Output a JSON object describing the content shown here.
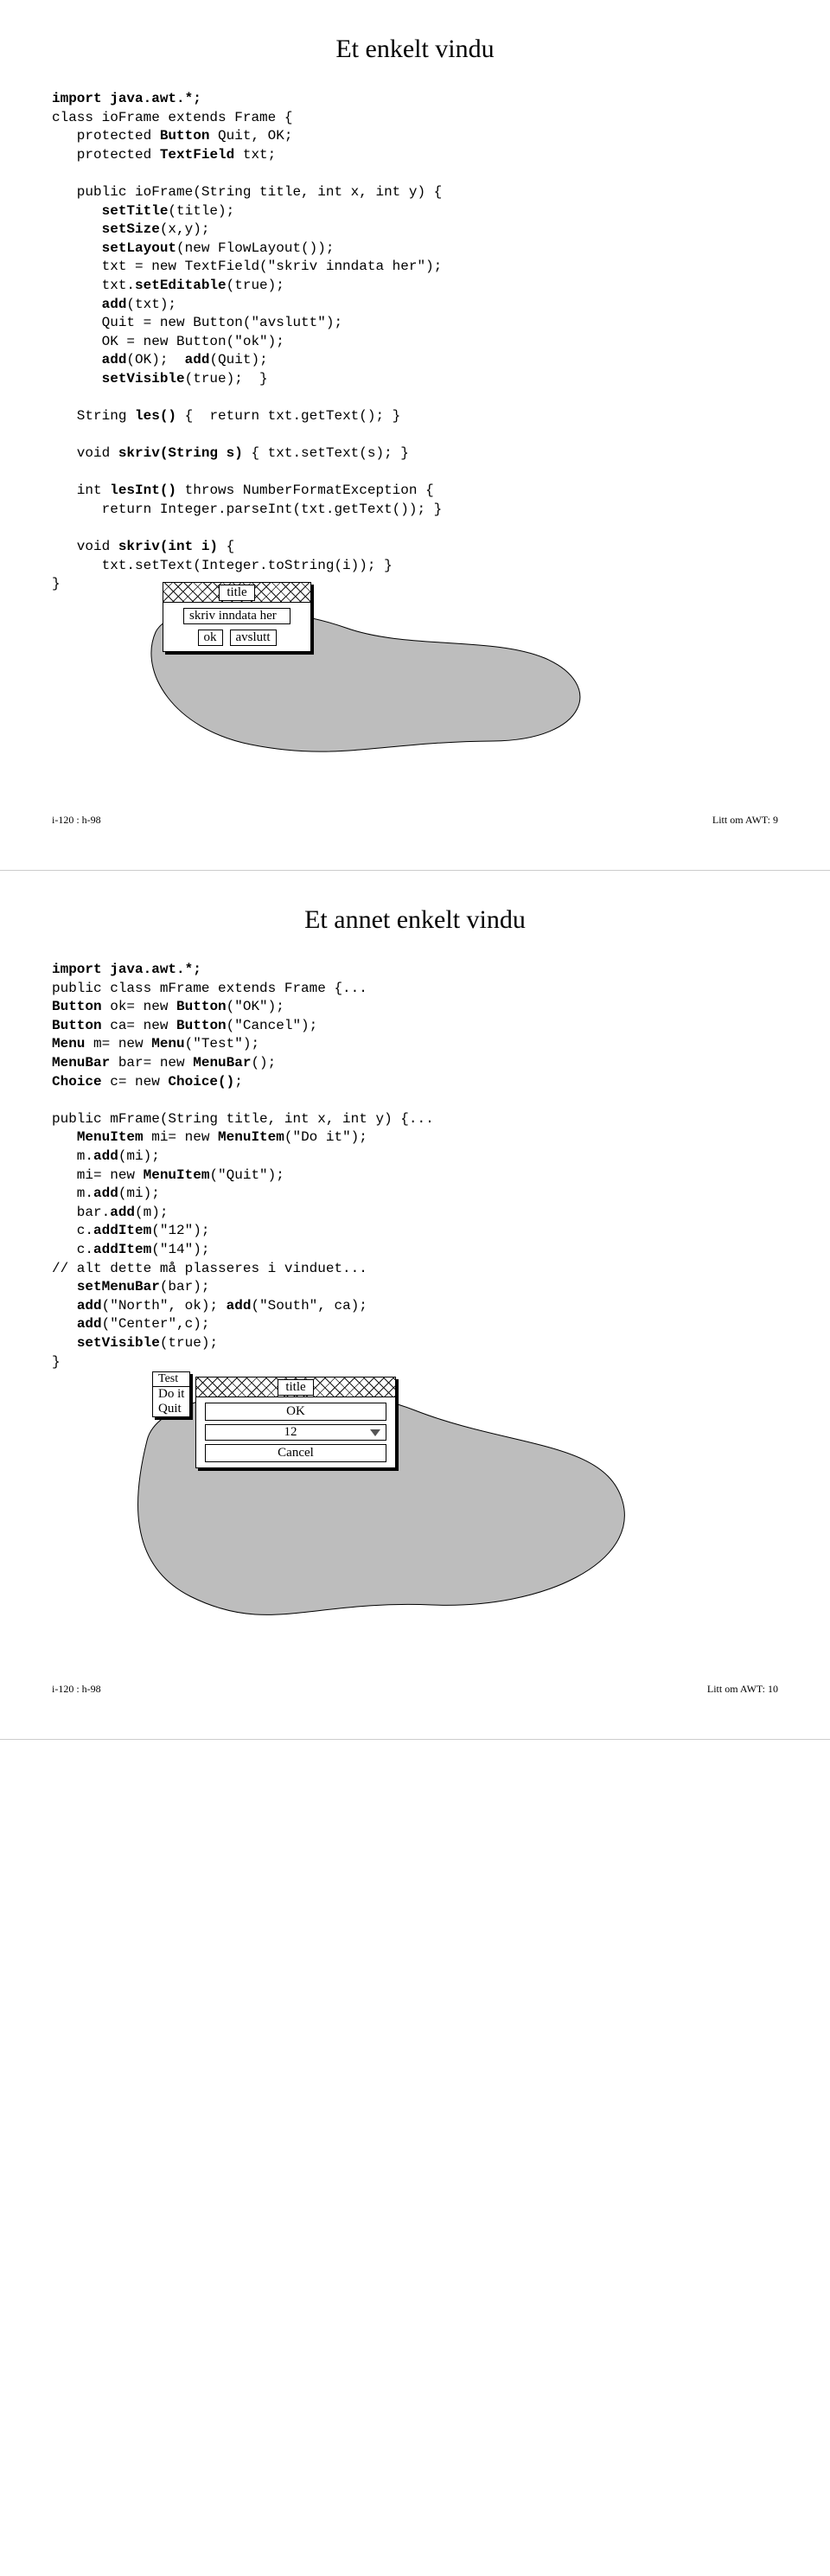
{
  "page1": {
    "title": "Et enkelt vindu",
    "code_lines": [
      [
        {
          "t": "import java.awt.*;",
          "b": 1
        }
      ],
      [
        {
          "t": "class ioFrame extends Frame {",
          "b": 0
        }
      ],
      [
        {
          "t": "   protected ",
          "b": 0
        },
        {
          "t": "Button",
          "b": 1
        },
        {
          "t": " Quit, OK;",
          "b": 0
        }
      ],
      [
        {
          "t": "   protected ",
          "b": 0
        },
        {
          "t": "TextField",
          "b": 1
        },
        {
          "t": " txt;",
          "b": 0
        }
      ],
      [],
      [
        {
          "t": "   public ioFrame(String title, int x, int y) {",
          "b": 0
        }
      ],
      [
        {
          "t": "      ",
          "b": 0
        },
        {
          "t": "setTitle",
          "b": 1
        },
        {
          "t": "(title);",
          "b": 0
        }
      ],
      [
        {
          "t": "      ",
          "b": 0
        },
        {
          "t": "setSize",
          "b": 1
        },
        {
          "t": "(x,y);",
          "b": 0
        }
      ],
      [
        {
          "t": "      ",
          "b": 0
        },
        {
          "t": "setLayout",
          "b": 1
        },
        {
          "t": "(new FlowLayout());",
          "b": 0
        }
      ],
      [
        {
          "t": "      txt = new TextField(\"skriv inndata her\");",
          "b": 0
        }
      ],
      [
        {
          "t": "      txt.",
          "b": 0
        },
        {
          "t": "setEditable",
          "b": 1
        },
        {
          "t": "(true);",
          "b": 0
        }
      ],
      [
        {
          "t": "      ",
          "b": 0
        },
        {
          "t": "add",
          "b": 1
        },
        {
          "t": "(txt);",
          "b": 0
        }
      ],
      [
        {
          "t": "      Quit = new Button(\"avslutt\");",
          "b": 0
        }
      ],
      [
        {
          "t": "      OK = new Button(\"ok\");",
          "b": 0
        }
      ],
      [
        {
          "t": "      ",
          "b": 0
        },
        {
          "t": "add",
          "b": 1
        },
        {
          "t": "(OK);  ",
          "b": 0
        },
        {
          "t": "add",
          "b": 1
        },
        {
          "t": "(Quit);",
          "b": 0
        }
      ],
      [
        {
          "t": "      ",
          "b": 0
        },
        {
          "t": "setVisible",
          "b": 1
        },
        {
          "t": "(true);  }",
          "b": 0
        }
      ],
      [],
      [
        {
          "t": "   String ",
          "b": 0
        },
        {
          "t": "les()",
          "b": 1
        },
        {
          "t": " {  return txt.getText(); }",
          "b": 0
        }
      ],
      [],
      [
        {
          "t": "   void ",
          "b": 0
        },
        {
          "t": "skriv(String s)",
          "b": 1
        },
        {
          "t": " { txt.setText(s); }",
          "b": 0
        }
      ],
      [],
      [
        {
          "t": "   int ",
          "b": 0
        },
        {
          "t": "lesInt()",
          "b": 1
        },
        {
          "t": " throws NumberFormatException {",
          "b": 0
        }
      ],
      [
        {
          "t": "      return Integer.parseInt(txt.getText()); }",
          "b": 0
        }
      ],
      [],
      [
        {
          "t": "   void ",
          "b": 0
        },
        {
          "t": "skriv(int i)",
          "b": 1
        },
        {
          "t": " {",
          "b": 0
        }
      ],
      [
        {
          "t": "      txt.setText(Integer.toString(i)); }",
          "b": 0
        }
      ],
      [
        {
          "t": "}",
          "b": 0
        }
      ]
    ],
    "window": {
      "title": "title",
      "textfield": "skriv inndata her",
      "btn_ok": "ok",
      "btn_quit": "avslutt"
    },
    "footer_left": "i-120 : h-98",
    "footer_right": "Litt om AWT:   9"
  },
  "page2": {
    "title": "Et annet enkelt vindu",
    "code_lines": [
      [
        {
          "t": "import java.awt.*;",
          "b": 1
        }
      ],
      [
        {
          "t": "public class mFrame extends Frame {...",
          "b": 0
        }
      ],
      [
        {
          "t": "Button",
          "b": 1
        },
        {
          "t": " ok= new ",
          "b": 0
        },
        {
          "t": "Button",
          "b": 1
        },
        {
          "t": "(\"OK\");",
          "b": 0
        }
      ],
      [
        {
          "t": "Button",
          "b": 1
        },
        {
          "t": " ca= new ",
          "b": 0
        },
        {
          "t": "Button",
          "b": 1
        },
        {
          "t": "(\"Cancel\");",
          "b": 0
        }
      ],
      [
        {
          "t": "Menu",
          "b": 1
        },
        {
          "t": " m= new ",
          "b": 0
        },
        {
          "t": "Menu",
          "b": 1
        },
        {
          "t": "(\"Test\");",
          "b": 0
        }
      ],
      [
        {
          "t": "MenuBar",
          "b": 1
        },
        {
          "t": " bar= new ",
          "b": 0
        },
        {
          "t": "MenuBar",
          "b": 1
        },
        {
          "t": "();",
          "b": 0
        }
      ],
      [
        {
          "t": "Choice",
          "b": 1
        },
        {
          "t": " c= new ",
          "b": 0
        },
        {
          "t": "Choice()",
          "b": 1
        },
        {
          "t": ";",
          "b": 0
        }
      ],
      [],
      [
        {
          "t": "public mFrame(String title, int x, int y) {...",
          "b": 0
        }
      ],
      [
        {
          "t": "   ",
          "b": 0
        },
        {
          "t": "MenuItem",
          "b": 1
        },
        {
          "t": " mi= new ",
          "b": 0
        },
        {
          "t": "MenuItem",
          "b": 1
        },
        {
          "t": "(\"Do it\");",
          "b": 0
        }
      ],
      [
        {
          "t": "   m.",
          "b": 0
        },
        {
          "t": "add",
          "b": 1
        },
        {
          "t": "(mi);",
          "b": 0
        }
      ],
      [
        {
          "t": "   mi= new ",
          "b": 0
        },
        {
          "t": "MenuItem",
          "b": 1
        },
        {
          "t": "(\"Quit\");",
          "b": 0
        }
      ],
      [
        {
          "t": "   m.",
          "b": 0
        },
        {
          "t": "add",
          "b": 1
        },
        {
          "t": "(mi);",
          "b": 0
        }
      ],
      [
        {
          "t": "   bar.",
          "b": 0
        },
        {
          "t": "add",
          "b": 1
        },
        {
          "t": "(m);",
          "b": 0
        }
      ],
      [
        {
          "t": "   c.",
          "b": 0
        },
        {
          "t": "addItem",
          "b": 1
        },
        {
          "t": "(\"12\");",
          "b": 0
        }
      ],
      [
        {
          "t": "   c.",
          "b": 0
        },
        {
          "t": "addItem",
          "b": 1
        },
        {
          "t": "(\"14\");",
          "b": 0
        }
      ],
      [
        {
          "t": "// alt dette må plasseres i vinduet...",
          "b": 0
        }
      ],
      [
        {
          "t": "   ",
          "b": 0
        },
        {
          "t": "setMenuBar",
          "b": 1
        },
        {
          "t": "(bar);",
          "b": 0
        }
      ],
      [
        {
          "t": "   ",
          "b": 0
        },
        {
          "t": "add",
          "b": 1
        },
        {
          "t": "(\"North\", ok); ",
          "b": 0
        },
        {
          "t": "add",
          "b": 1
        },
        {
          "t": "(\"South\", ca);",
          "b": 0
        }
      ],
      [
        {
          "t": "   ",
          "b": 0
        },
        {
          "t": "add",
          "b": 1
        },
        {
          "t": "(\"Center\",c);",
          "b": 0
        }
      ],
      [
        {
          "t": "   ",
          "b": 0
        },
        {
          "t": "setVisible",
          "b": 1
        },
        {
          "t": "(true);",
          "b": 0
        }
      ],
      [
        {
          "t": "}",
          "b": 0
        }
      ]
    ],
    "window": {
      "title": "title",
      "menu_head": "Test",
      "menu_items": [
        "Do it",
        "Quit"
      ],
      "north": "OK",
      "choice": "12",
      "south": "Cancel"
    },
    "footer_left": "i-120 : h-98",
    "footer_right": "Litt om AWT:   10"
  }
}
